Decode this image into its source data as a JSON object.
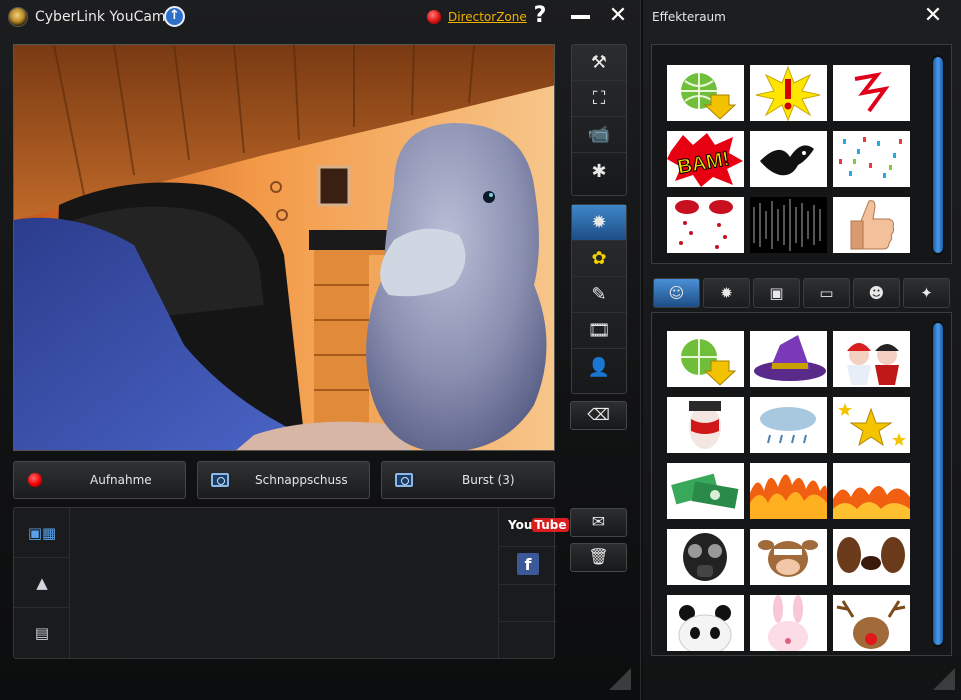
{
  "app": {
    "title": "CyberLink YouCam",
    "director_zone": "DirectorZone",
    "help": "?",
    "minimize": "—",
    "close": "✕"
  },
  "capture": {
    "record": "Aufnahme",
    "snapshot": "Schnappschuss",
    "burst": "Burst (3)"
  },
  "share": {
    "youtube_a": "You",
    "youtube_b": "Tube",
    "facebook": "f"
  },
  "effects_window": {
    "title": "Effekteraum",
    "close": "✕",
    "top_thumbs": [
      "download-effect",
      "exclamation-burst",
      "red-lightning",
      "bam-comic",
      "black-bird",
      "confetti-swirl",
      "red-hearts-rain",
      "sound-wave",
      "thumbs-up"
    ],
    "tabs": [
      "face-tracking",
      "particle",
      "frame",
      "filter",
      "emotion",
      "magic"
    ],
    "bottom_thumbs": [
      "download-effect",
      "witch-hat",
      "angel-devil",
      "opera-mask",
      "rain-cloud",
      "gold-stars",
      "money-bills",
      "fire-big",
      "fire-small",
      "gas-mask",
      "cow-mask",
      "dog-ears",
      "panda",
      "bunny",
      "reindeer"
    ]
  },
  "colors": {
    "accent": "#2f6fc8",
    "link": "#f2b300",
    "record": "#e00000"
  }
}
